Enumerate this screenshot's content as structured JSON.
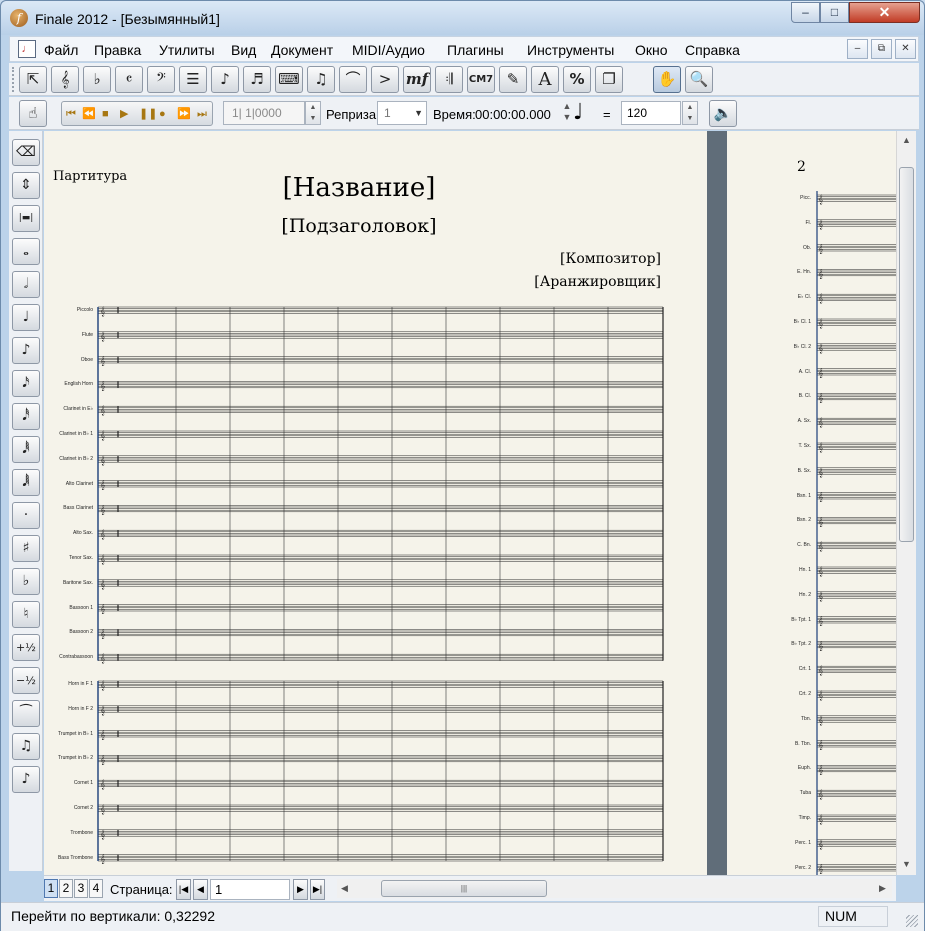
{
  "window": {
    "title": "Finale 2012 - [Безымянный1]",
    "icon": "finale-logo-icon",
    "app_icon_glyph": "f",
    "minimize": "–",
    "maximize": "□",
    "close": "✕"
  },
  "menubar": {
    "items": [
      "Файл",
      "Правка",
      "Утилиты",
      "Вид",
      "Документ",
      "MIDI/Аудио",
      "Плагины",
      "Инструменты",
      "Окно",
      "Справка"
    ],
    "mdi_buttons": [
      "–",
      "⧉",
      "✕"
    ]
  },
  "toolbar_main": {
    "tools": [
      "selection-tool",
      "staff-tool",
      "key-signature-tool",
      "time-signature-tool",
      "clef-tool",
      "measure-tool",
      "simple-entry-tool",
      "speedy-entry-tool",
      "hyperscribe-tool",
      "tuplet-tool",
      "smart-shape-tool",
      "articulation-tool",
      "expression-tool",
      "repeat-tool",
      "chord-tool",
      "lyrics-tool",
      "text-tool",
      "resize-tool",
      "page-layout-tool",
      "hand-grabber-tool",
      "zoom-tool"
    ],
    "expression_label": "mf",
    "chord_label": "CM7",
    "text_label": "A",
    "resize_label": "%"
  },
  "playback": {
    "counter": "1| 1|0000",
    "repeat_label": "Реприза:",
    "repeat_value": "1",
    "time_label": "Время:",
    "time_value": "00:00:00.000",
    "equals": "=",
    "tempo": "120"
  },
  "score": {
    "label": "Партитура",
    "title": "[Название]",
    "subtitle": "[Подзаголовок]",
    "composer": "[Композитор]",
    "arranger": "[Аранжировщик]",
    "page2_number": "2",
    "instruments": [
      "Piccolo",
      "Flute",
      "Oboe",
      "English Horn",
      "Clarinet in E♭",
      "Clarinet in B♭ 1",
      "Clarinet in B♭ 2",
      "Alto Clarinet",
      "Bass Clarinet",
      "Alto Sax.",
      "Tenor Sax.",
      "Baritone Sax.",
      "Bassoon 1",
      "Bassoon 2",
      "Contrabassoon",
      "Horn in F 1",
      "Horn in F 2",
      "Trumpet in B♭ 1",
      "Trumpet in B♭ 2",
      "Cornet 1",
      "Cornet 2",
      "Trombone",
      "Bass Trombone"
    ],
    "page2_instruments": [
      "Picc.",
      "Fl.",
      "Ob.",
      "E. Hn.",
      "E♭ Cl.",
      "B♭ Cl. 1",
      "B♭ Cl. 2",
      "A. Cl.",
      "B. Cl.",
      "A. Sx.",
      "T. Sx.",
      "B. Sx.",
      "Bsn. 1",
      "Bsn. 2",
      "C. Bn.",
      "Hn. 1",
      "Hn. 2",
      "B♭ Tpt. 1",
      "B♭ Tpt. 2",
      "Crt. 1",
      "Crt. 2",
      "Tbn.",
      "B. Tbn.",
      "Euph.",
      "Tuba",
      "Timp.",
      "Perc. 1",
      "Perc. 2"
    ]
  },
  "pagination": {
    "tabs": [
      "1",
      "2",
      "3",
      "4"
    ],
    "active": "1",
    "label": "Страница:",
    "value": "1"
  },
  "status": {
    "text": "Перейти по вертикали: 0,32292",
    "num": "NUM"
  }
}
